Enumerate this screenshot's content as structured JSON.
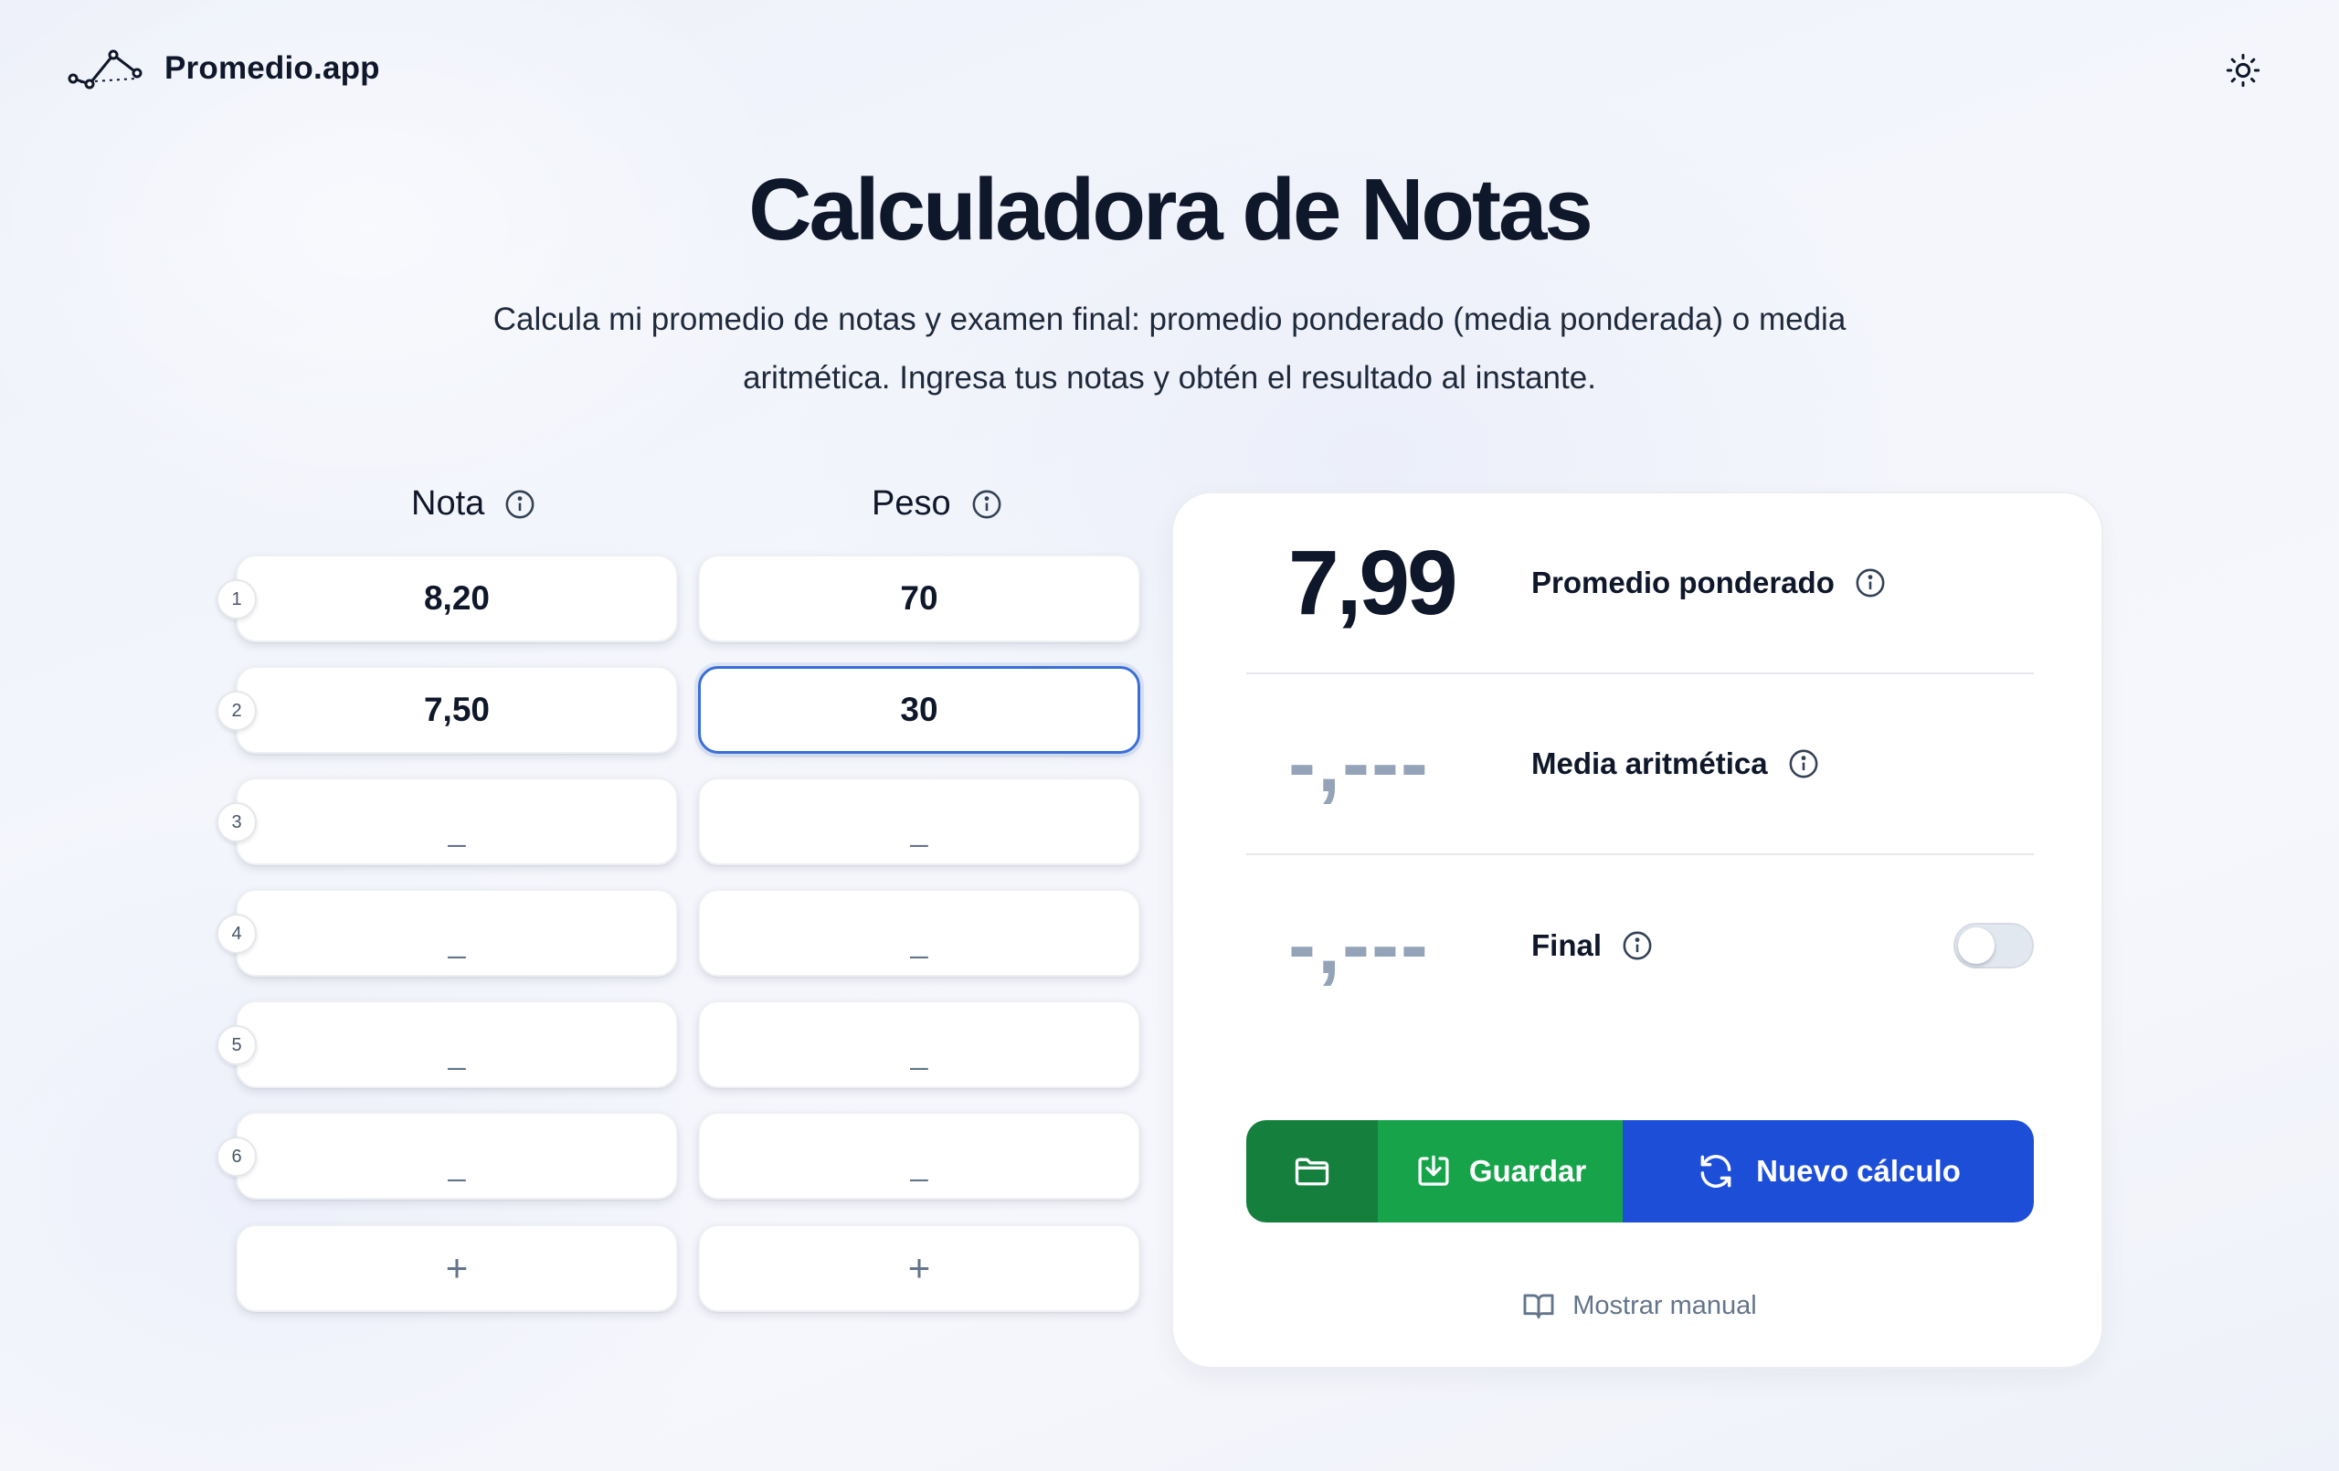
{
  "app": {
    "name": "Promedio.app",
    "theme_icon": "sun-icon"
  },
  "hero": {
    "title": "Calculadora de Notas",
    "subtitle_line1": "Calcula mi promedio de notas y examen final: promedio ponderado (media ponderada) o media",
    "subtitle_line2": "aritmética. Ingresa tus notas y obtén el resultado al instante."
  },
  "table": {
    "headers": {
      "grade": "Nota",
      "weight": "Peso"
    },
    "rows": [
      {
        "num": "1",
        "grade": "8,20",
        "weight": "70"
      },
      {
        "num": "2",
        "grade": "7,50",
        "weight": "30"
      },
      {
        "num": "3",
        "grade": "_",
        "weight": "_"
      },
      {
        "num": "4",
        "grade": "_",
        "weight": "_"
      },
      {
        "num": "5",
        "grade": "_",
        "weight": "_"
      },
      {
        "num": "6",
        "grade": "_",
        "weight": "_"
      }
    ],
    "add_label": "+"
  },
  "results": {
    "weighted": {
      "value": "7,99",
      "label": "Promedio ponderado"
    },
    "arithmetic": {
      "value": "-,---",
      "label": "Media aritmética"
    },
    "final": {
      "value": "-,---",
      "label": "Final",
      "enabled": false
    }
  },
  "actions": {
    "save": "Guardar",
    "new": "Nuevo cálculo",
    "manual": "Mostrar manual"
  },
  "colors": {
    "save_dark": "#15803d",
    "save": "#16a34a",
    "new": "#1d4ed8",
    "active_border": "#3b6fd8"
  }
}
